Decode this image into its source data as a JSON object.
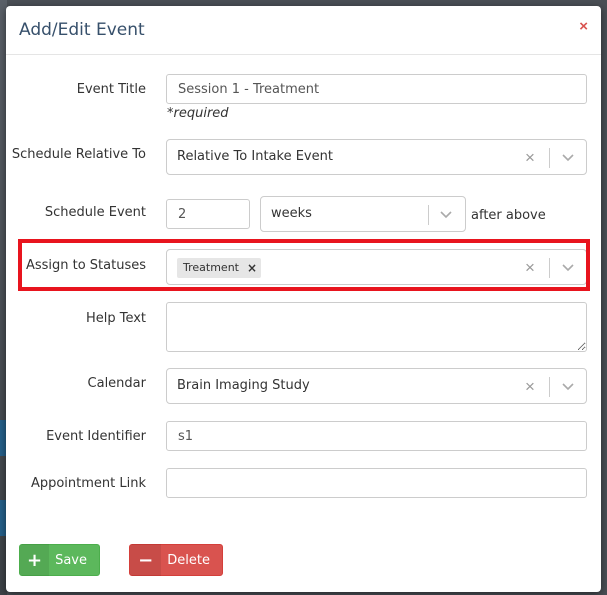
{
  "modal": {
    "title": "Add/Edit Event",
    "close_glyph": "×"
  },
  "form": {
    "event_title": {
      "label": "Event Title",
      "value": "Session 1 - Treatment",
      "hint": "*required"
    },
    "schedule_relative_to": {
      "label": "Schedule Relative To",
      "value": "Relative To Intake Event"
    },
    "schedule_event": {
      "label": "Schedule Event",
      "amount": "2",
      "unit": "weeks",
      "suffix": "after above"
    },
    "assign_to_statuses": {
      "label": "Assign to Statuses",
      "tags": [
        "Treatment"
      ]
    },
    "help_text": {
      "label": "Help Text",
      "value": ""
    },
    "calendar": {
      "label": "Calendar",
      "value": "Brain Imaging Study"
    },
    "event_identifier": {
      "label": "Event Identifier",
      "value": "s1"
    },
    "appointment_link": {
      "label": "Appointment Link",
      "value": ""
    }
  },
  "buttons": {
    "save_label": "Save",
    "delete_label": "Delete"
  },
  "colors": {
    "save": "#5cb85c",
    "delete": "#d9534f",
    "highlight": "#e8141e",
    "title": "#37506b"
  },
  "icons": {
    "close": "close-icon",
    "plus": "plus-icon",
    "minus": "minus-icon",
    "chevron": "chevron-down-icon",
    "clear": "clear-icon"
  }
}
